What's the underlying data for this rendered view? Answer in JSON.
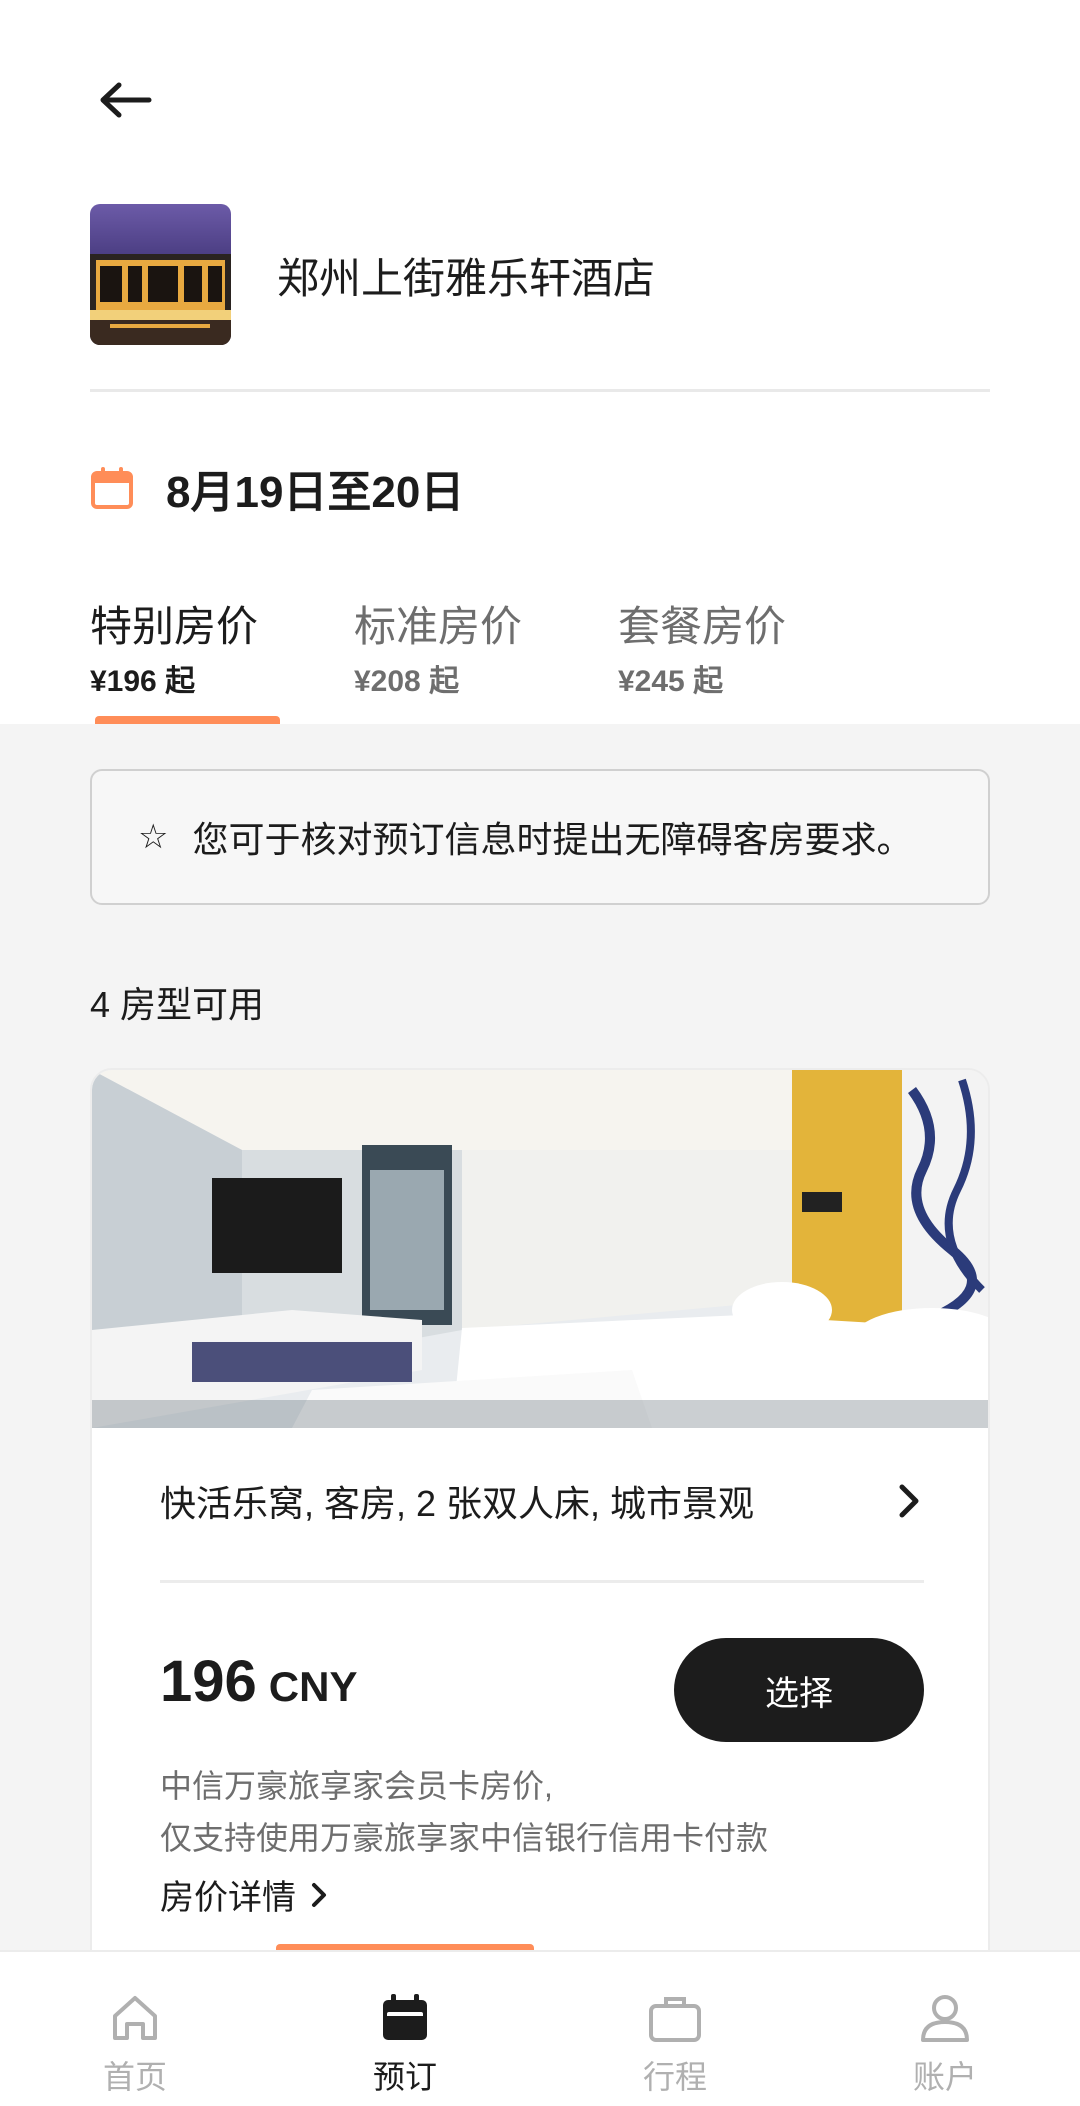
{
  "hotel": {
    "name": "郑州上街雅乐轩酒店"
  },
  "stay": {
    "dates": "8月19日至20日"
  },
  "rate_tabs": [
    {
      "title": "特别房价",
      "price": "¥196 起",
      "active": true
    },
    {
      "title": "标准房价",
      "price": "¥208 起",
      "active": false
    },
    {
      "title": "套餐房价",
      "price": "¥245 起",
      "active": false
    }
  ],
  "notice": {
    "text": "您可于核对预订信息时提出无障碍客房要求。"
  },
  "rooms": {
    "count_label": "4 房型可用"
  },
  "room_card": {
    "title": "快活乐窝, 客房, 2 张双人床, 城市景观",
    "price": "196",
    "currency": "CNY",
    "select_label": "选择",
    "desc_line1": "中信万豪旅享家会员卡房价,",
    "desc_line2": "仅支持使用万豪旅享家中信银行信用卡付款",
    "detail_link": "房价详情"
  },
  "nav": [
    {
      "label": "首页",
      "icon": "home-icon",
      "active": false
    },
    {
      "label": "预订",
      "icon": "calendar-icon",
      "active": true
    },
    {
      "label": "行程",
      "icon": "briefcase-icon",
      "active": false
    },
    {
      "label": "账户",
      "icon": "user-icon",
      "active": false
    }
  ],
  "colors": {
    "accent": "#ff8d58",
    "text": "#1c1c1c",
    "muted": "#6e6e6e",
    "background": "#f4f4f4",
    "button": "#1c1c1c"
  }
}
